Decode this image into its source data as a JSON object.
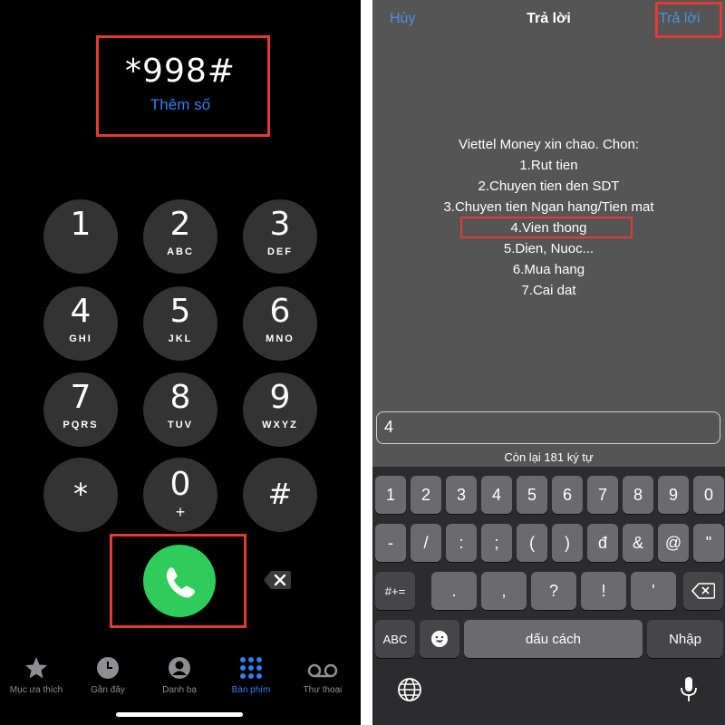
{
  "dialer": {
    "number": "*998#",
    "add_number": "Thêm số",
    "keys": [
      {
        "digit": "1",
        "letters": ""
      },
      {
        "digit": "2",
        "letters": "ABC"
      },
      {
        "digit": "3",
        "letters": "DEF"
      },
      {
        "digit": "4",
        "letters": "GHI"
      },
      {
        "digit": "5",
        "letters": "JKL"
      },
      {
        "digit": "6",
        "letters": "MNO"
      },
      {
        "digit": "7",
        "letters": "PQRS"
      },
      {
        "digit": "8",
        "letters": "TUV"
      },
      {
        "digit": "9",
        "letters": "WXYZ"
      },
      {
        "digit": "*",
        "letters": ""
      },
      {
        "digit": "0",
        "letters": "+"
      },
      {
        "digit": "#",
        "letters": ""
      }
    ],
    "tabs": [
      {
        "label": "Mục ưa thích",
        "icon": "star-icon"
      },
      {
        "label": "Gần đây",
        "icon": "clock-icon"
      },
      {
        "label": "Danh bạ",
        "icon": "contact-icon"
      },
      {
        "label": "Bàn phím",
        "icon": "keypad-icon",
        "active": true
      },
      {
        "label": "Thư thoại",
        "icon": "voicemail-icon"
      }
    ],
    "colors": {
      "call": "#2ecc5a",
      "accent": "#2f80ed",
      "highlight": "#e53935"
    }
  },
  "ussd": {
    "cancel": "Hủy",
    "title": "Trả lời",
    "reply": "Trả lời",
    "message_lines": [
      "Viettel Money xin chao. Chon:",
      "1.Rut tien",
      "2.Chuyen tien den SDT",
      "3.Chuyen tien Ngan hang/Tien mat",
      "4.Vien thong",
      "5.Dien, Nuoc...",
      "6.Mua hang",
      "7.Cai dat"
    ],
    "input_value": "4",
    "remaining": "Còn lại 181 ký tự"
  },
  "keyboard": {
    "row1": [
      "1",
      "2",
      "3",
      "4",
      "5",
      "6",
      "7",
      "8",
      "9",
      "0"
    ],
    "row2": [
      "-",
      "/",
      ":",
      ";",
      "(",
      ")",
      "đ",
      "&",
      "@",
      "\""
    ],
    "row3_shift": "#+=",
    "row3": [
      ".",
      ",",
      "?",
      "!",
      "'"
    ],
    "abc": "ABC",
    "space": "dấu cách",
    "return": "Nhập"
  }
}
